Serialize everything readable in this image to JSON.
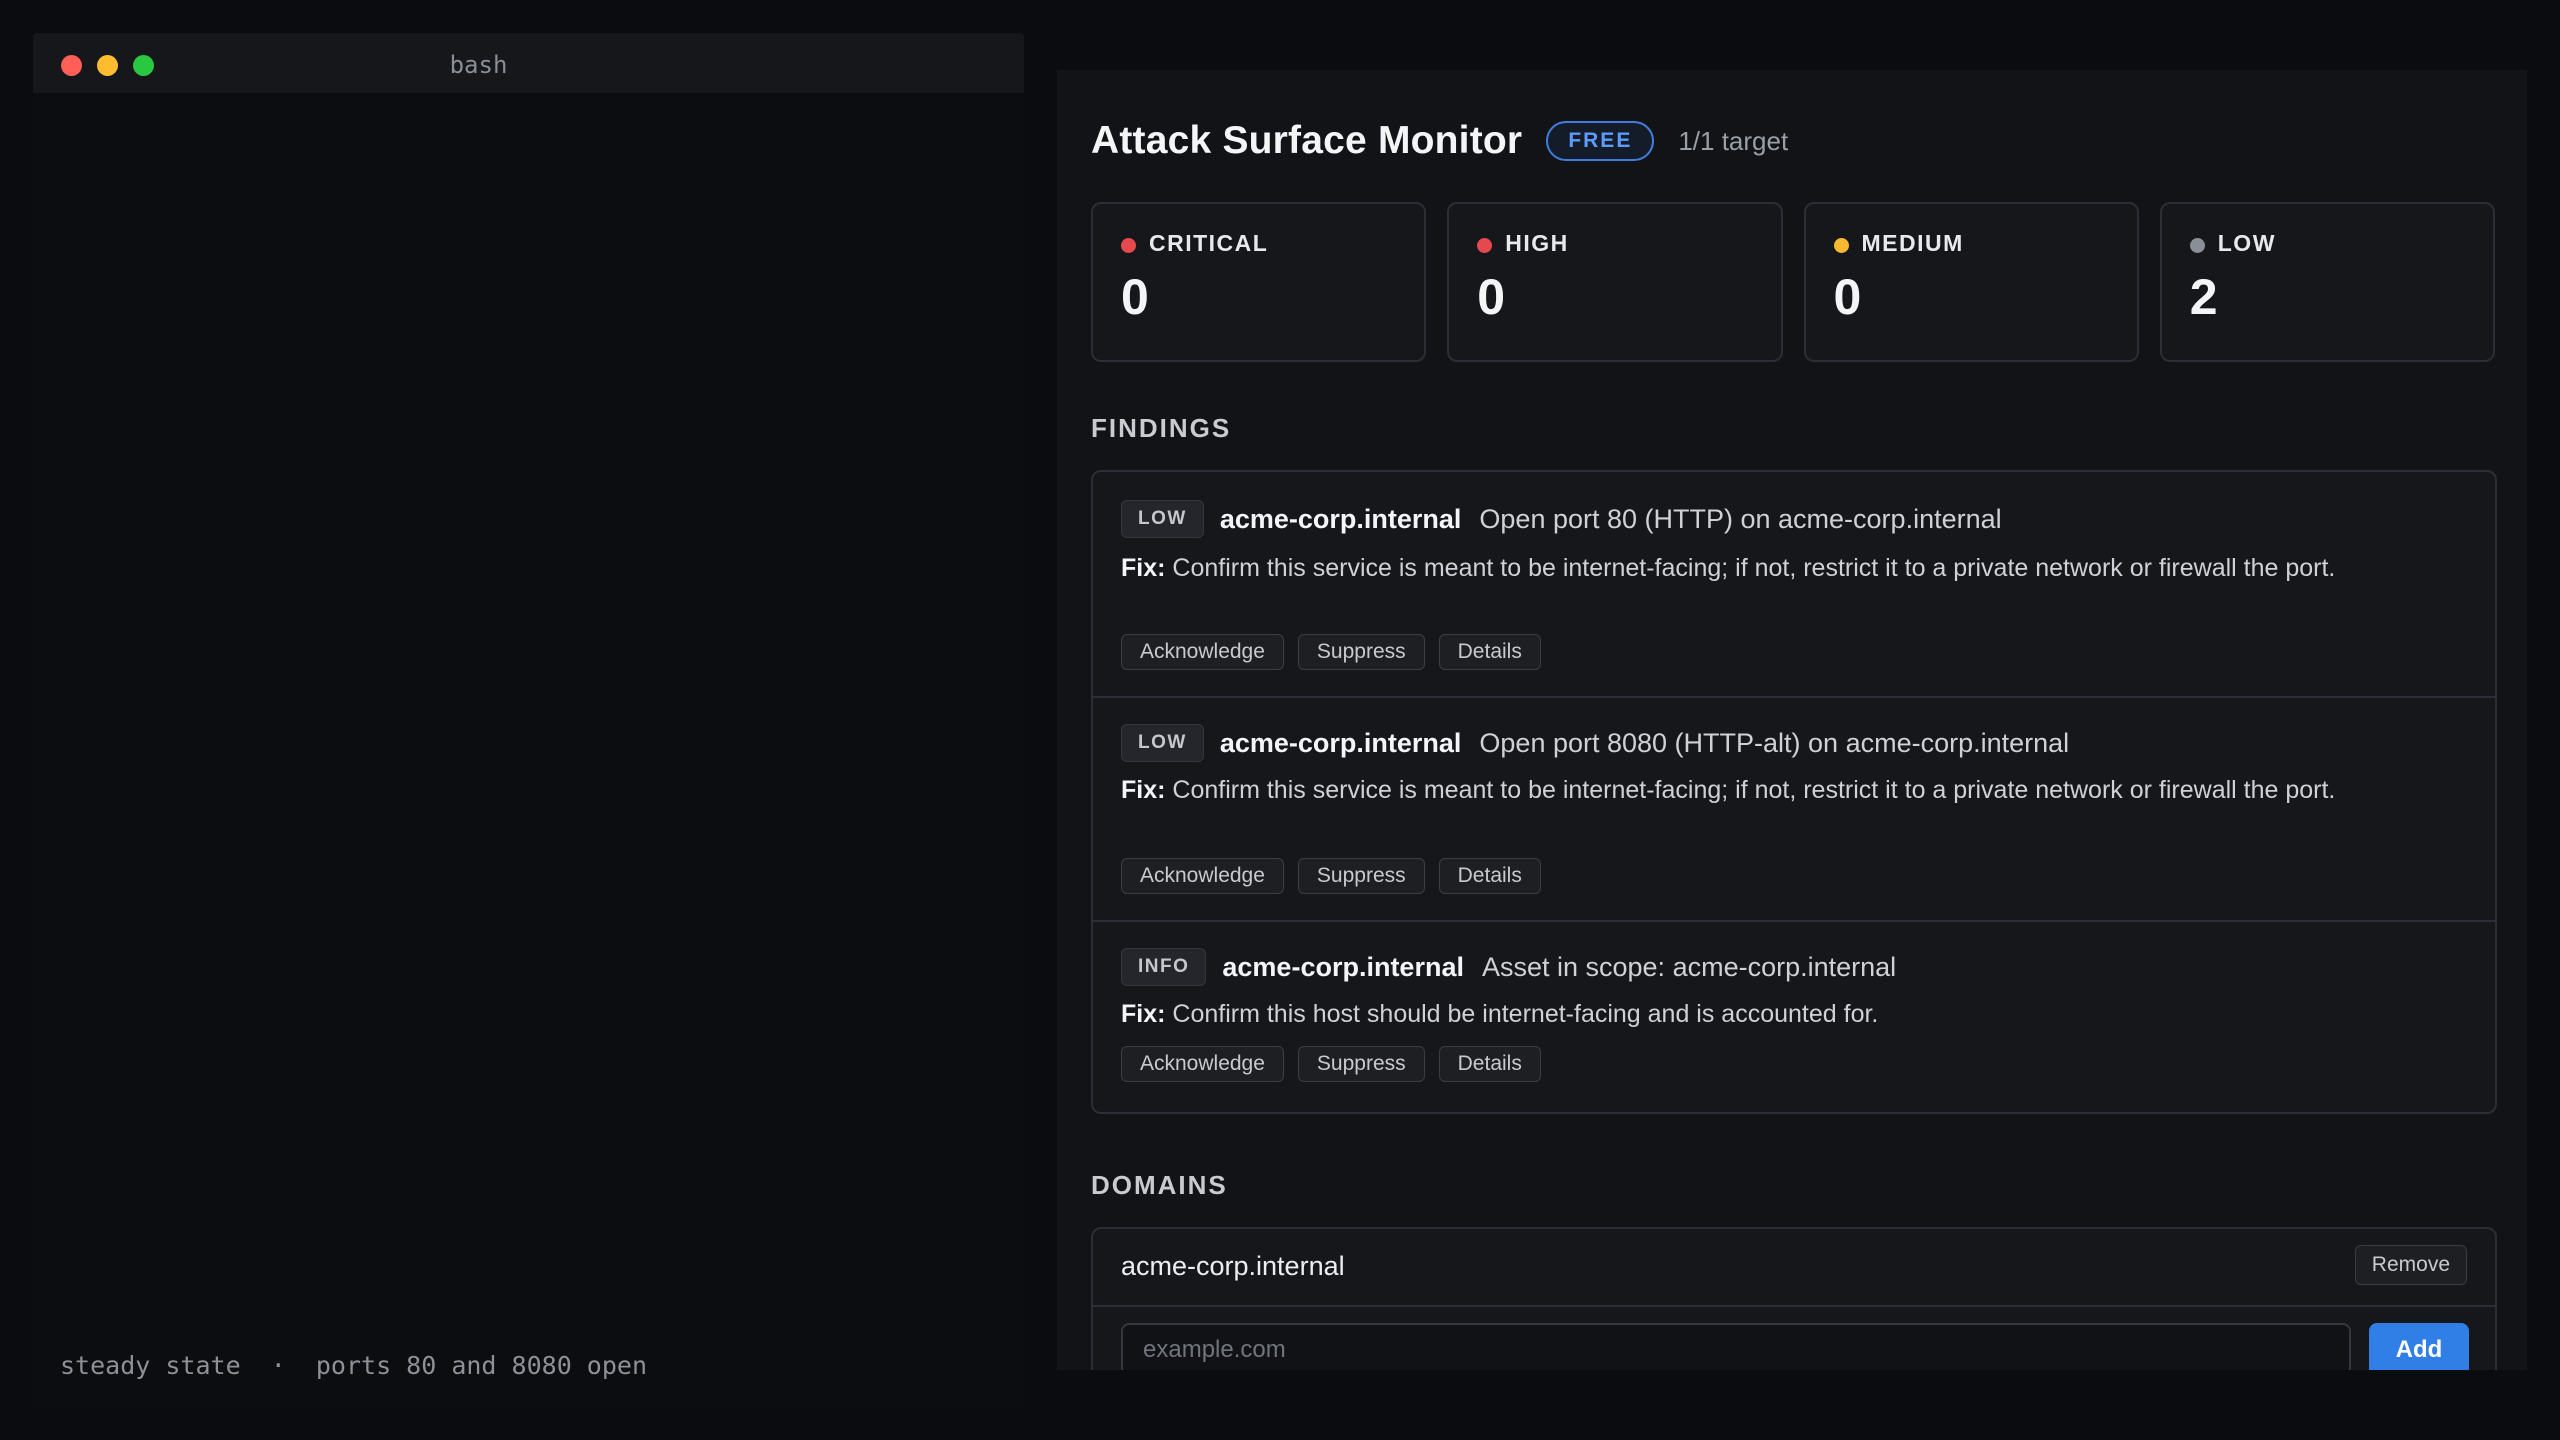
{
  "terminal": {
    "title": "bash",
    "status_line": "steady state  ·  ports 80 and 8080 open"
  },
  "app": {
    "title": "Attack Surface Monitor",
    "plan_badge": "FREE",
    "target_count": "1/1 target"
  },
  "severity_cards": [
    {
      "label": "CRITICAL",
      "count": "0",
      "color": "#e5484d"
    },
    {
      "label": "HIGH",
      "count": "0",
      "color": "#e5484d"
    },
    {
      "label": "MEDIUM",
      "count": "0",
      "color": "#f5b82e"
    },
    {
      "label": "LOW",
      "count": "2",
      "color": "#8a8e96"
    }
  ],
  "findings_section": {
    "title": "FINDINGS",
    "items": [
      {
        "severity": "LOW",
        "host": "acme-corp.internal",
        "title": "Open port 80 (HTTP) on acme-corp.internal",
        "fix_label": "Fix:",
        "fix": "Confirm this service is meant to be internet-facing; if not, restrict it to a private network or firewall the port.",
        "actions": [
          "Acknowledge",
          "Suppress",
          "Details"
        ]
      },
      {
        "severity": "LOW",
        "host": "acme-corp.internal",
        "title": "Open port 8080 (HTTP-alt) on acme-corp.internal",
        "fix_label": "Fix:",
        "fix": "Confirm this service is meant to be internet-facing; if not, restrict it to a private network or firewall the port.",
        "actions": [
          "Acknowledge",
          "Suppress",
          "Details"
        ]
      },
      {
        "severity": "INFO",
        "host": "acme-corp.internal",
        "title": "Asset in scope: acme-corp.internal",
        "fix_label": "Fix:",
        "fix": "Confirm this host should be internet-facing and is accounted for.",
        "actions": [
          "Acknowledge",
          "Suppress",
          "Details"
        ]
      }
    ]
  },
  "domains_section": {
    "title": "DOMAINS",
    "domains": [
      {
        "name": "acme-corp.internal",
        "remove_label": "Remove"
      }
    ],
    "input_placeholder": "example.com",
    "input_value": "",
    "add_label": "Add"
  },
  "colors": {
    "accent": "#2f7fe6",
    "background": "#0b0c0f",
    "panel": "#121316"
  }
}
